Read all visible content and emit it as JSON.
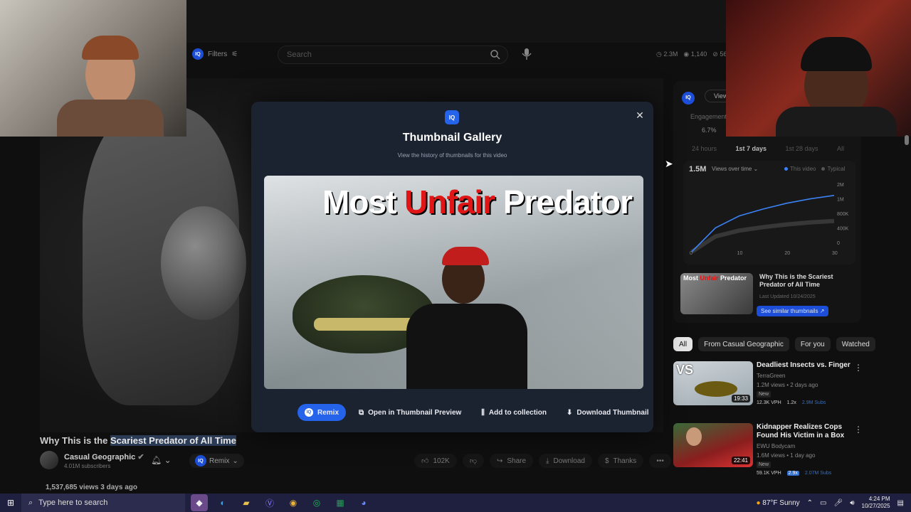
{
  "header": {
    "filters_label": "Filters",
    "search_placeholder": "Search",
    "stats": [
      "2.3M",
      "1,140",
      "56."
    ]
  },
  "video": {
    "title_prefix": "Why This is the",
    "title_highlight": "Scariest Predator of All Time",
    "channel": "Casual Geographic",
    "subscribers": "4.01M subscribers",
    "views_date": "1,537,685 views  3 days ago",
    "remix_label": "Remix",
    "actions": {
      "likes": "102K",
      "share": "Share",
      "download": "Download",
      "thanks": "Thanks"
    }
  },
  "analytics": {
    "iq_badge": "IQ",
    "view_button": "View",
    "engagement_label": "Engagement",
    "engagement_value": "6.7%",
    "tabs": [
      "24 hours",
      "1st 7 days",
      "1st 28 days",
      "All"
    ],
    "active_tab": "1st 7 days",
    "big_value": "1.5M",
    "metric_select": "Views over time",
    "legend": [
      "This video",
      "Typical"
    ],
    "colors": {
      "this_video": "#3b82f6",
      "typical": "#555555"
    }
  },
  "chart_data": {
    "type": "line",
    "title": "",
    "x": [
      0,
      5,
      10,
      15,
      20,
      25,
      30
    ],
    "x_ticks": [
      "0",
      "10",
      "20",
      "30"
    ],
    "y_ticks": [
      "2M",
      "1M",
      "800K",
      "400K",
      "0"
    ],
    "series": [
      {
        "name": "This video",
        "values": [
          0,
          0.7,
          1.05,
          1.25,
          1.42,
          1.55,
          1.65
        ]
      },
      {
        "name": "Typical",
        "values": [
          0,
          0.45,
          0.62,
          0.72,
          0.8,
          0.86,
          0.9
        ]
      }
    ]
  },
  "similar": {
    "title": "Why This is the Scariest Predator of All Time",
    "last_updated": "Last Updated 10/24/2025",
    "button": "See similar thumbnails"
  },
  "chips": [
    "All",
    "From Casual Geographic",
    "For you",
    "Watched"
  ],
  "recommendations": [
    {
      "title": "Deadliest Insects vs. Finger",
      "channel": "TerraGreen",
      "meta": "1.2M views • 2 days ago",
      "badge": "New",
      "duration": "19:33",
      "vph": "12.3K VPH",
      "multiplier": "1.2x",
      "subs": "2.9M Subs"
    },
    {
      "title": "Kidnapper Realizes Cops Found His Victim in a Box",
      "channel": "EWU Bodycam",
      "meta": "1.6M views • 1 day ago",
      "badge": "New",
      "duration": "22:41",
      "vph": "59.1K VPH",
      "multiplier": "2.9x",
      "subs": "2.07M Subs"
    }
  ],
  "modal": {
    "logo": "IQ",
    "title": "Thumbnail Gallery",
    "subtitle": "View the history of thumbnails for this video",
    "thumbnail_text": [
      "Most",
      "Unfair",
      "Predator"
    ],
    "buttons": {
      "remix": "Remix",
      "open_preview": "Open in Thumbnail Preview",
      "add_collection": "Add to collection",
      "download": "Download Thumbnail"
    }
  },
  "taskbar": {
    "search_placeholder": "Type here to search",
    "weather": "87°F  Sunny",
    "time": "4:24 PM",
    "date": "10/27/2025"
  }
}
